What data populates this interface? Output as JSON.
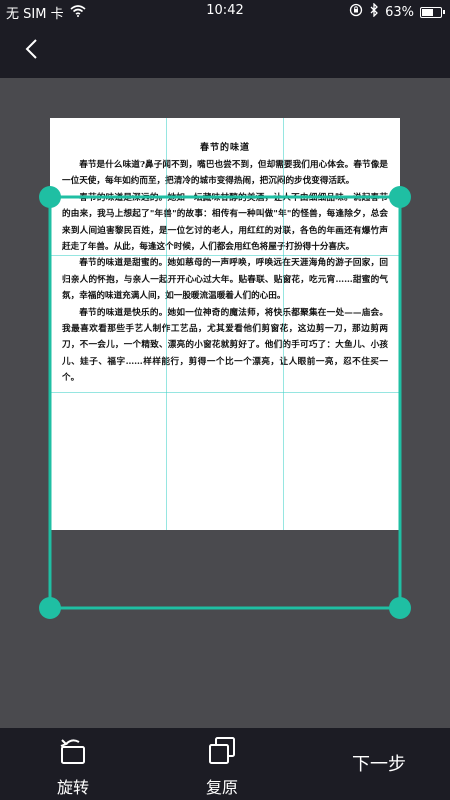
{
  "status_bar": {
    "carrier": "无 SIM 卡",
    "time": "10:42",
    "battery_percent": "63%",
    "battery_level": 0.63
  },
  "nav": {
    "back_icon": "chevron-left-icon"
  },
  "document": {
    "title": "春节的味道",
    "paragraphs": [
      "春节是什么味道?鼻子闻不到，嘴巴也尝不到，但却需要我们用心体会。春节像是一位天使，每年如约而至，把清冷的城市变得热闹，把沉闷的步伐变得活跃。",
      "春节的味道是深远的。她如一坛藏味甘醇的美酒，让人不由细细品味。说起春节的由来，我马上想起了\"年兽\"的故事：相传有一种叫做\"年\"的怪兽，每逢除夕，总会来到人间迫害黎民百姓，是一位乞讨的老人，用红红的对联，各色的年画还有爆竹声赶走了年兽。从此，每逢这个时候，人们都会用红色将屋子打扮得十分喜庆。",
      "春节的味道是甜蜜的。她如慈母的一声呼唤，呼唤远在天涯海角的游子回家，回归亲人的怀抱，与亲人一起开开心心过大年。贴春联、贴窗花，吃元宵……甜蜜的气氛，幸福的味道充满人间，如一股暖流温暖着人们的心田。",
      "春节的味道是快乐的。她如一位神奇的魔法师，将快乐都聚集在一处——庙会。我最喜欢看那些手艺人制作工艺品，尤其爱看他们剪窗花，这边剪一刀，那边剪两刀，不一会儿，一个精致、漂亮的小窗花就剪好了。他们的手可巧了：大鱼儿、小孩儿、娃子、福字……样样能行，剪得一个比一个漂亮，让人眼前一亮，忍不住买一个。"
    ]
  },
  "toolbar": {
    "rotate_label": "旋转",
    "restore_label": "复原",
    "next_label": "下一步"
  },
  "colors": {
    "accent": "#1fbfa3",
    "bar_background": "#1c1c24",
    "workspace_background": "#4a4a4e"
  }
}
